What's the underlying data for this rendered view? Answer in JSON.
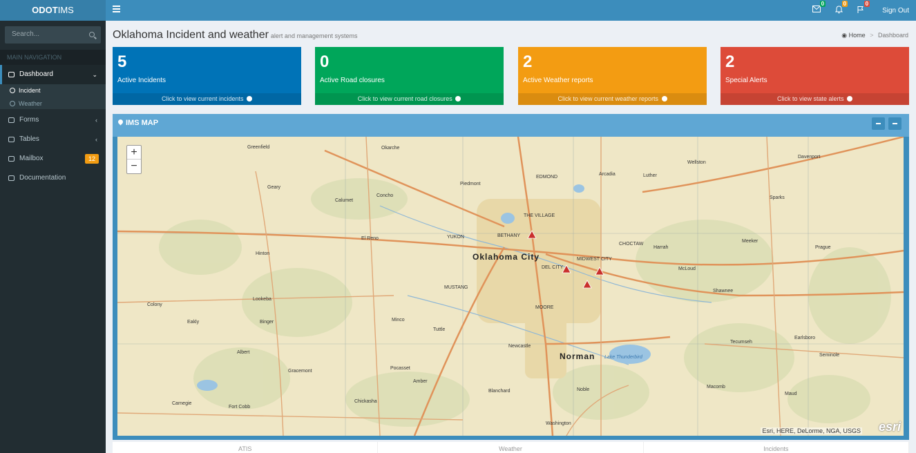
{
  "app": {
    "logo_bold": "ODOT",
    "logo_rest": "IMS"
  },
  "topbar": {
    "icons": [
      {
        "name": "envelope-icon",
        "count": "0",
        "color": "#00a65a"
      },
      {
        "name": "bell-icon",
        "count": "0",
        "color": "#f39c12"
      },
      {
        "name": "flag-icon",
        "count": "0",
        "color": "#dd4b39"
      }
    ],
    "sign_out": "Sign Out"
  },
  "sidebar": {
    "search_placeholder": "Search...",
    "nav_header": "MAIN NAVIGATION",
    "dashboard": "Dashboard",
    "sub": {
      "incident": "Incident",
      "weather": "Weather"
    },
    "forms": "Forms",
    "tables": "Tables",
    "mailbox": "Mailbox",
    "mailbox_count": "12",
    "documentation": "Documentation"
  },
  "header": {
    "title": "Oklahoma Incident and weather",
    "subtitle": "alert and management systems",
    "breadcrumb_home": "Home",
    "breadcrumb_current": "Dashboard"
  },
  "cards": [
    {
      "value": "5",
      "label": "Active Incidents",
      "link": "Click to view current incidents",
      "color": "#0073b7"
    },
    {
      "value": "0",
      "label": "Active Road closures",
      "link": "Click to view current road closures",
      "color": "#00a65a"
    },
    {
      "value": "2",
      "label": "Active Weather reports",
      "link": "Click to view current weather reports",
      "color": "#f39c12"
    },
    {
      "value": "2",
      "label": "Special Alerts",
      "link": "Click to view state alerts",
      "color": "#dd4b39"
    }
  ],
  "map": {
    "title": "IMS MAP",
    "attribution": "Esri, HERE, DeLorme, NGA, USGS",
    "esri_logo": "esri",
    "cities": {
      "okc": "Oklahoma City",
      "norman": "Norman",
      "edmond": "EDMOND",
      "yukon": "YUKON",
      "mustang": "MUSTANG",
      "moore": "MOORE",
      "bethany": "BETHANY",
      "midwest_city": "MIDWEST CITY",
      "choctaw": "CHOCTAW",
      "del_city": "DEL CITY",
      "the_village": "THE VILLAGE",
      "el_reno": "El Reno",
      "chickasha": "Chickasha",
      "hinton": "Hinton",
      "minco": "Minco",
      "tuttle": "Tuttle",
      "shawnee": "Shawnee",
      "tecumseh": "Tecumseh",
      "newcastle": "Newcastle",
      "blanchard": "Blanchard",
      "washington": "Washington",
      "calumet": "Calumet",
      "concho": "Concho",
      "piedmont": "Piedmont",
      "arcadia": "Arcadia",
      "luther": "Luther",
      "wellston": "Wellston",
      "harrah": "Harrah",
      "mcloud": "McLoud",
      "meeker": "Meeker",
      "prague": "Prague",
      "binger": "Binger",
      "lookeba": "Lookeba",
      "eakly": "Eakly",
      "colony": "Colony",
      "albert": "Albert",
      "carnegie": "Carnegie",
      "fort_cobb": "Fort Cobb",
      "anadarko": "Gracemont",
      "pocasset": "Pocasset",
      "amber": "Amber",
      "noble": "Noble",
      "macomb": "Macomb",
      "maud": "Maud",
      "earlsboro": "Earlsboro",
      "seminole": "Seminole",
      "lake_thunderbird": "Lake Thunderbird",
      "sparks": "Sparks",
      "davenport": "Davenport",
      "geary": "Geary",
      "greenfield": "Greenfield",
      "okarche": "Okarche"
    }
  },
  "bottom_tabs": [
    "ATIS",
    "Weather",
    "Incidents"
  ]
}
